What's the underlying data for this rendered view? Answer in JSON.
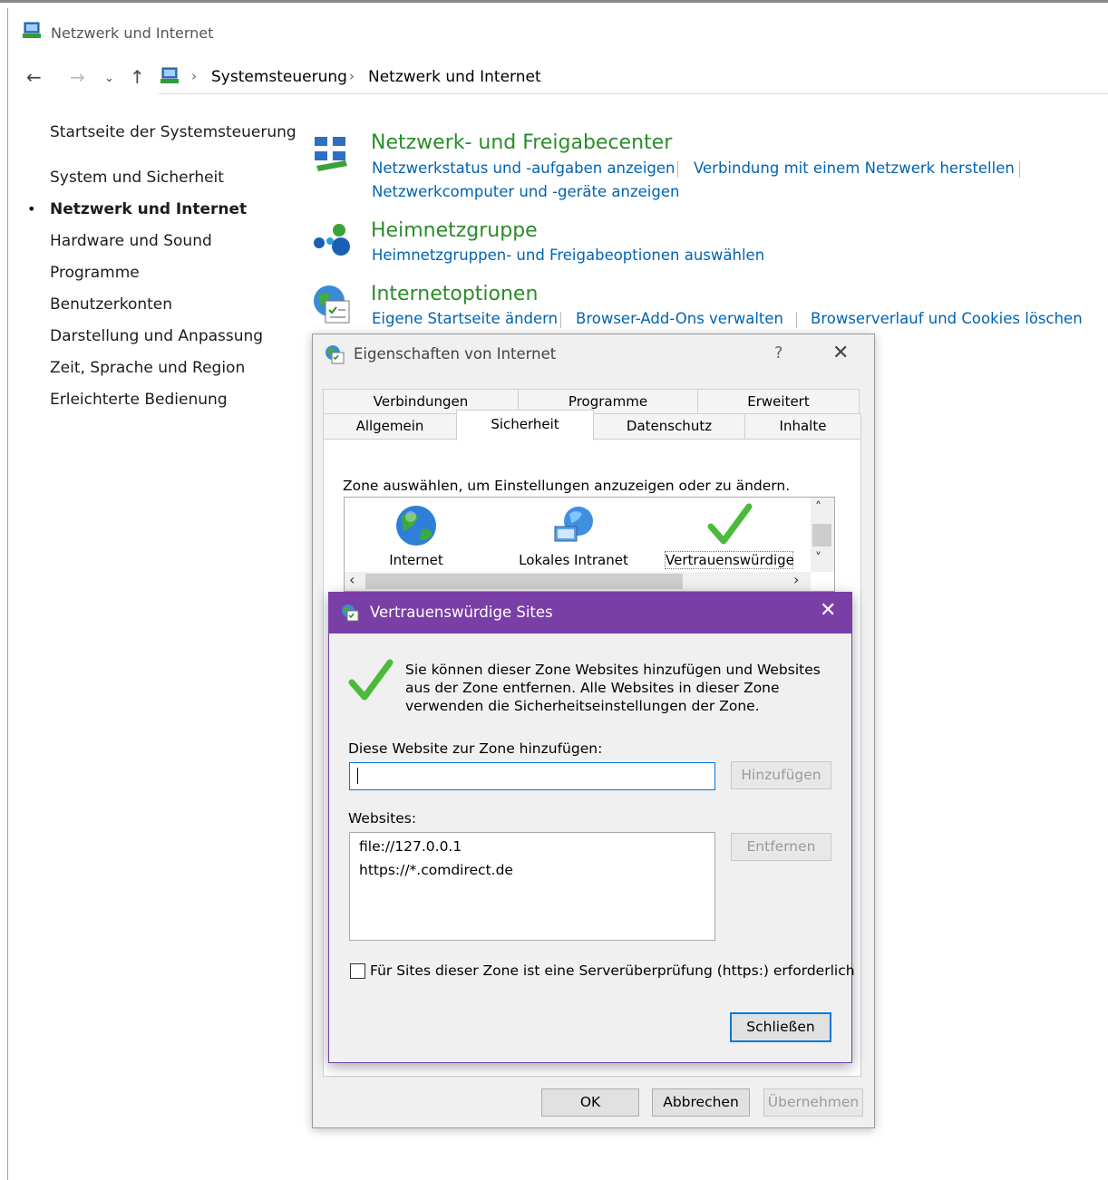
{
  "window": {
    "title": "Netzwerk und Internet",
    "breadcrumb": [
      "Systemsteuerung",
      "Netzwerk und Internet"
    ]
  },
  "sidebar": {
    "items": [
      {
        "label": "Startseite der Systemsteuerung"
      },
      {
        "label": "System und Sicherheit"
      },
      {
        "label": "Netzwerk und Internet",
        "active": true
      },
      {
        "label": "Hardware und Sound"
      },
      {
        "label": "Programme"
      },
      {
        "label": "Benutzerkonten"
      },
      {
        "label": "Darstellung und Anpassung"
      },
      {
        "label": "Zeit, Sprache und Region"
      },
      {
        "label": "Erleichterte Bedienung"
      }
    ]
  },
  "categories": [
    {
      "title": "Netzwerk- und Freigabecenter",
      "links": [
        "Netzwerkstatus und -aufgaben anzeigen",
        "Verbindung mit einem Netzwerk herstellen",
        "Netzwerkcomputer und -geräte anzeigen"
      ]
    },
    {
      "title": "Heimnetzgruppe",
      "links": [
        "Heimnetzgruppen- und Freigabeoptionen auswählen"
      ]
    },
    {
      "title": "Internetoptionen",
      "links": [
        "Eigene Startseite ändern",
        "Browser-Add-Ons verwalten",
        "Browserverlauf und Cookies löschen"
      ]
    }
  ],
  "internet_properties": {
    "title": "Eigenschaften von Internet",
    "help": "?",
    "close": "✕",
    "tabs_row1": [
      "Verbindungen",
      "Programme",
      "Erweitert"
    ],
    "tabs_row2": [
      "Allgemein",
      "Sicherheit",
      "Datenschutz",
      "Inhalte"
    ],
    "active_tab": "Sicherheit",
    "zone_caption": "Zone auswählen, um Einstellungen anzuzeigen oder zu ändern.",
    "zones": [
      "Internet",
      "Lokales Intranet",
      "Vertrauenswürdige"
    ],
    "buttons": {
      "ok": "OK",
      "cancel": "Abbrechen",
      "apply": "Übernehmen"
    }
  },
  "trusted_sites": {
    "title": "Vertrauenswürdige Sites",
    "close": "✕",
    "description": "Sie können dieser Zone Websites hinzufügen und Websites aus der Zone entfernen. Alle Websites in dieser Zone verwenden die Sicherheitseinstellungen der Zone.",
    "add_label": "Diese Website zur Zone hinzufügen:",
    "add_value": "",
    "add_button": "Hinzufügen",
    "websites_label": "Websites:",
    "websites": [
      "file://127.0.0.1",
      "https://*.comdirect.de"
    ],
    "remove_button": "Entfernen",
    "https_checkbox_label": "Für Sites dieser Zone ist eine Serverüberprüfung (https:) erforderlich",
    "https_checked": false,
    "close_button": "Schließen"
  },
  "colors": {
    "category_title": "#2a8c2a",
    "link": "#0063b1",
    "dialog_titlebar": "#7a3fa6"
  }
}
